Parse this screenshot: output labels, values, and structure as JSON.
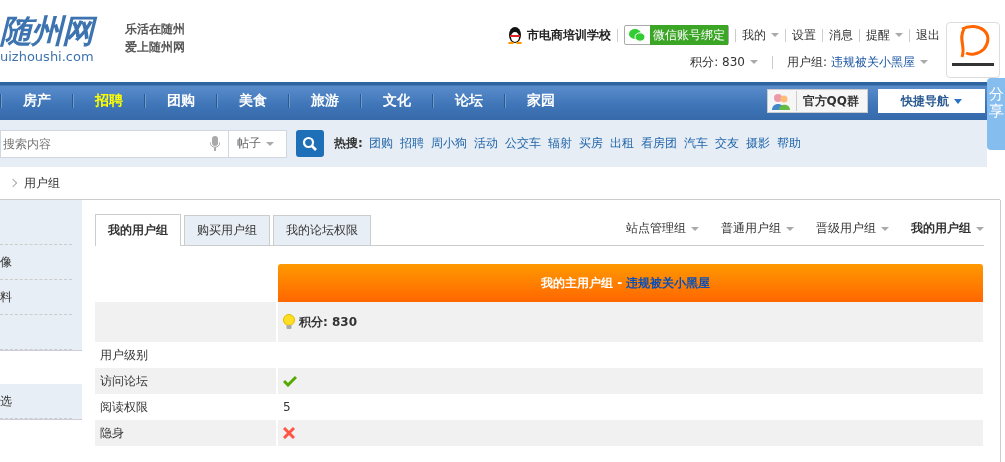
{
  "header": {
    "logo": "随州网",
    "domain": "uizhoushi.com",
    "slogan": [
      "乐活在随州",
      "爱上随州网"
    ],
    "school": "市电商培训学校",
    "wechat": "微信账号绑定",
    "links": [
      {
        "label": "我的",
        "dropdown": true
      },
      {
        "label": "设置",
        "dropdown": false
      },
      {
        "label": "消息",
        "dropdown": false
      },
      {
        "label": "提醒",
        "dropdown": true
      },
      {
        "label": "退出",
        "dropdown": false
      }
    ],
    "points": "积分: 830",
    "group_label": "用户组:",
    "group_value": "违规被关小黑屋"
  },
  "nav": {
    "items": [
      {
        "label": "房产",
        "selected": false
      },
      {
        "label": "招聘",
        "selected": true
      },
      {
        "label": "团购",
        "selected": false
      },
      {
        "label": "美食",
        "selected": false
      },
      {
        "label": "旅游",
        "selected": false
      },
      {
        "label": "文化",
        "selected": false
      },
      {
        "label": "论坛",
        "selected": false
      },
      {
        "label": "家园",
        "selected": false
      }
    ],
    "qq_group": "官方QQ群",
    "quick_nav": "快捷导航"
  },
  "share_tab": "分享",
  "search": {
    "placeholder": "搜索内容",
    "type": "帖子",
    "hot_label": "热搜:",
    "hot": [
      "团购",
      "招聘",
      "周小狗",
      "活动",
      "公交车",
      "辐射",
      "买房",
      "出租",
      "看房团",
      "汽车",
      "交友",
      "摄影",
      "帮助"
    ]
  },
  "breadcrumb": "用户组",
  "sidebar": {
    "groups": [
      [
        "像",
        "料"
      ],
      [
        "选"
      ]
    ]
  },
  "tabs": [
    {
      "label": "我的用户组",
      "selected": true
    },
    {
      "label": "购买用户组",
      "selected": false
    },
    {
      "label": "我的论坛权限",
      "selected": false
    }
  ],
  "group_filters": [
    {
      "label": "站点管理组",
      "selected": false
    },
    {
      "label": "普通用户组",
      "selected": false
    },
    {
      "label": "晋级用户组",
      "selected": false
    },
    {
      "label": "我的用户组",
      "selected": true
    }
  ],
  "table": {
    "title": "我的主用户组 - ",
    "title_group": "违规被关小黑屋",
    "points": "积分: 830",
    "rows": [
      {
        "label": "用户级别",
        "kind": "text"
      },
      {
        "label": "访问论坛",
        "kind": "bool",
        "allowed": true
      },
      {
        "label": "阅读权限",
        "kind": "text",
        "value": "5"
      },
      {
        "label": "隐身",
        "kind": "bool",
        "allowed": false
      }
    ]
  }
}
